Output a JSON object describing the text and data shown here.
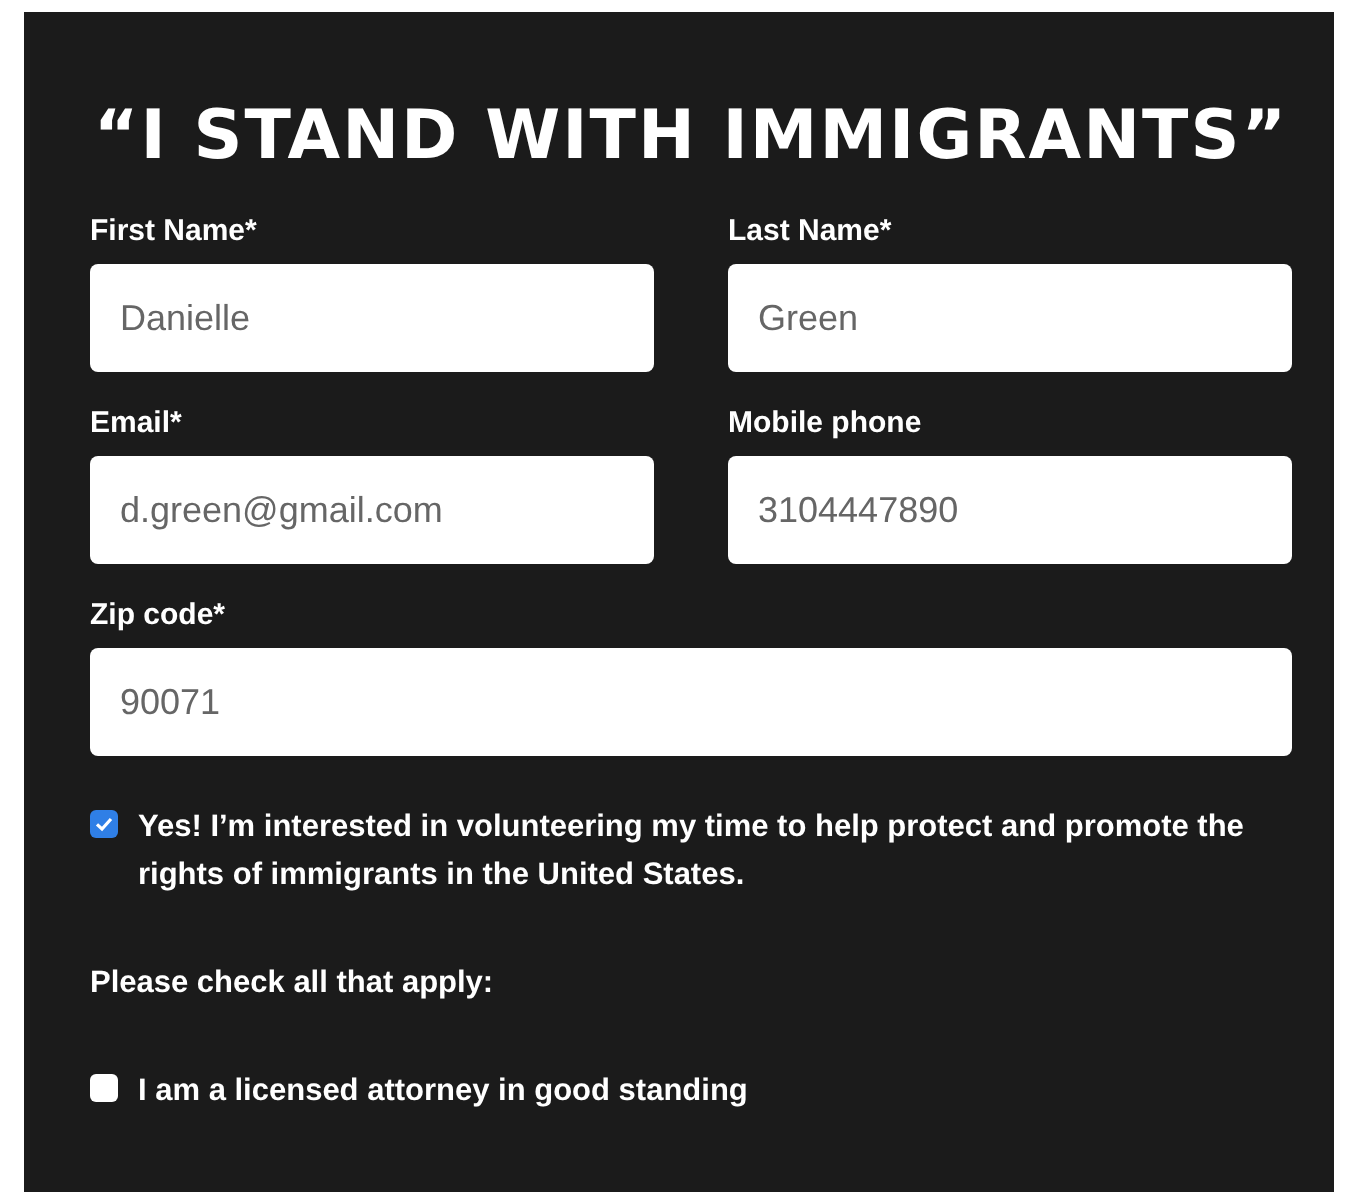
{
  "title": "“I STAND WITH IMMIGRANTS”",
  "field_rows": [
    {
      "fields": [
        {
          "label": "First Name*",
          "value": "Danielle"
        },
        {
          "label": "Last Name*",
          "value": "Green"
        }
      ]
    },
    {
      "fields": [
        {
          "label": "Email*",
          "value": "d.green@gmail.com"
        },
        {
          "label": "Mobile phone",
          "value": "3104447890"
        }
      ]
    },
    {
      "fields": [
        {
          "label": "Zip code*",
          "value": "90071"
        }
      ]
    }
  ],
  "volunteer": {
    "label": "Yes! I’m interested in volunteering my time to help protect and promote the rights of immigrants in the United States.",
    "checked": true
  },
  "prompt": "Please check all that apply:",
  "options": [
    {
      "label": "I am a licensed attorney in good standing",
      "checked": false
    }
  ]
}
